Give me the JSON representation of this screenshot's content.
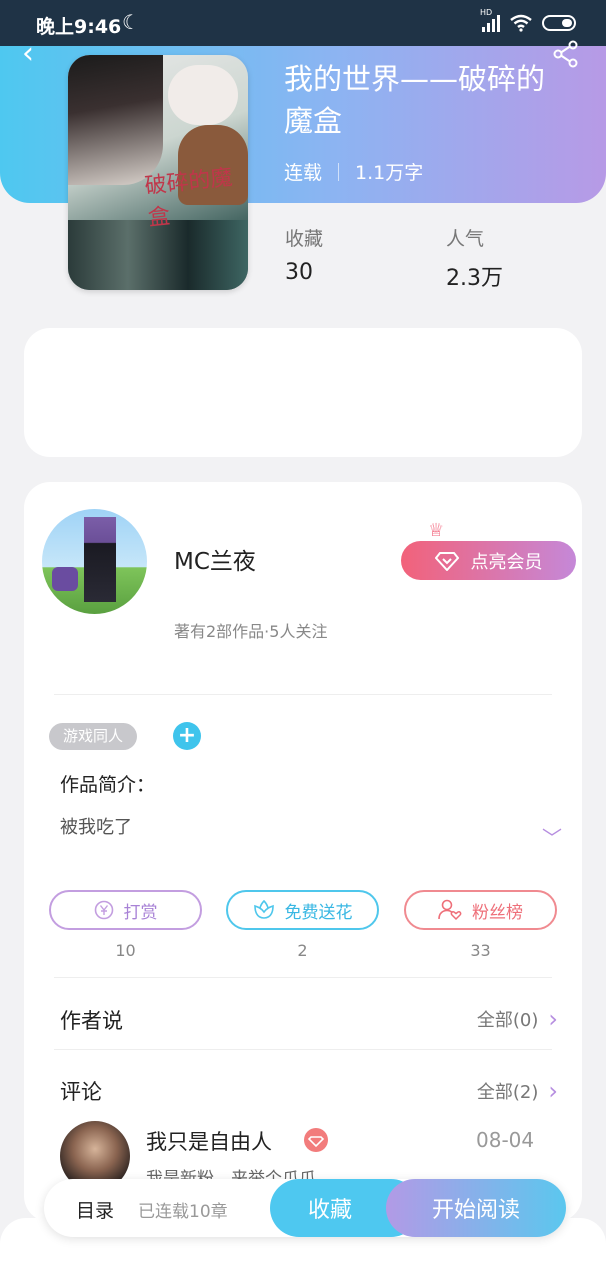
{
  "status_bar": {
    "time": "晚上9:46",
    "hd_label": "HD"
  },
  "book": {
    "title": "我的世界——破碎的魔盒",
    "status": "连载",
    "word_count": "1.1万字",
    "stats": [
      {
        "label": "收藏",
        "value": "30"
      },
      {
        "label": "人气",
        "value": "2.3万"
      }
    ],
    "cover_text": "破碎的魔盒"
  },
  "author": {
    "name": "MC兰夜",
    "info": "著有2部作品·5人关注",
    "vip_label": "点亮会员"
  },
  "tags": [
    "游戏同人"
  ],
  "intro": {
    "label": "作品简介：",
    "text": "被我吃了"
  },
  "actions": [
    {
      "label": "打赏",
      "count": "10",
      "icon": "yen-coin-icon"
    },
    {
      "label": "免费送花",
      "count": "2",
      "icon": "flower-icon"
    },
    {
      "label": "粉丝榜",
      "count": "33",
      "icon": "user-heart-icon"
    }
  ],
  "author_says": {
    "title": "作者说",
    "more": "全部(0)"
  },
  "comments": {
    "title": "评论",
    "more": "全部(2)",
    "items": [
      {
        "name": "我只是自由人",
        "date": "08-04",
        "text": "我是新粉，来举个爪爪"
      }
    ]
  },
  "bottom_bar": {
    "toc_label": "目录",
    "toc_sub": "已连载10章",
    "favorite_label": "收藏",
    "read_label": "开始阅读"
  },
  "colors": {
    "header_gradient": [
      "#4ec8f0",
      "#b79ae6"
    ],
    "accent_blue": "#4ec8f0",
    "accent_purple": "#b68ee0",
    "vip_pink": "#f2627a"
  }
}
